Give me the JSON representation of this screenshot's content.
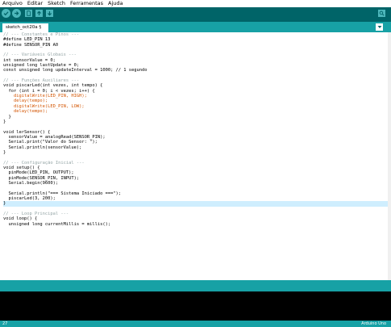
{
  "menu": [
    "Arquivo",
    "Editar",
    "Sketch",
    "Ferramentas",
    "Ajuda"
  ],
  "toolbar": {
    "verify_icon": "checkmark-icon",
    "upload_icon": "right-arrow-icon",
    "new_icon": "new-file-icon",
    "open_icon": "up-arrow-icon",
    "save_icon": "down-arrow-icon",
    "monitor_icon": "magnifier-icon"
  },
  "tab": {
    "label": "sketch_oct20a §"
  },
  "code_lines": [
    "// --- Constantes e Pinos ---",
    "#define LED_PIN 13",
    "#define SENSOR_PIN A0",
    "",
    "// --- Variáveis Globais ---",
    "int sensorValue = 0;",
    "unsigned long lastUpdate = 0;",
    "const unsigned long updateInterval = 1000; // 1 segundo",
    "",
    "// --- Funções Auxiliares ---",
    "void piscarLed(int vezes, int tempo) {",
    "  for (int i = 0; i < vezes; i++) {",
    "    digitalWrite(LED_PIN, HIGH);",
    "    delay(tempo);",
    "    digitalWrite(LED_PIN, LOW);",
    "    delay(tempo);",
    "  }",
    "}",
    "",
    "void lerSensor() {",
    "  sensorValue = analogRead(SENSOR_PIN);",
    "  Serial.print(\"Valor do Sensor: \");",
    "  Serial.println(sensorValue);",
    "}",
    "",
    "// --- Configuração Inicial ---",
    "void setup() {",
    "  pinMode(LED_PIN, OUTPUT);",
    "  pinMode(SENSOR_PIN, INPUT);",
    "  Serial.begin(9600);",
    "",
    "  Serial.println(\"=== Sistema Iniciado ===\");",
    "  piscarLed(3, 200);",
    "}",
    "",
    "// --- Loop Principal ---",
    "void loop() {",
    "  unsigned long currentMillis = millis();"
  ],
  "status": {
    "line_number": "27",
    "board": "Arduino Uno"
  },
  "colors": {
    "toolbar": "#006468",
    "tabbar": "#17a1a5",
    "button": "#4db7bb",
    "console": "#000000"
  }
}
